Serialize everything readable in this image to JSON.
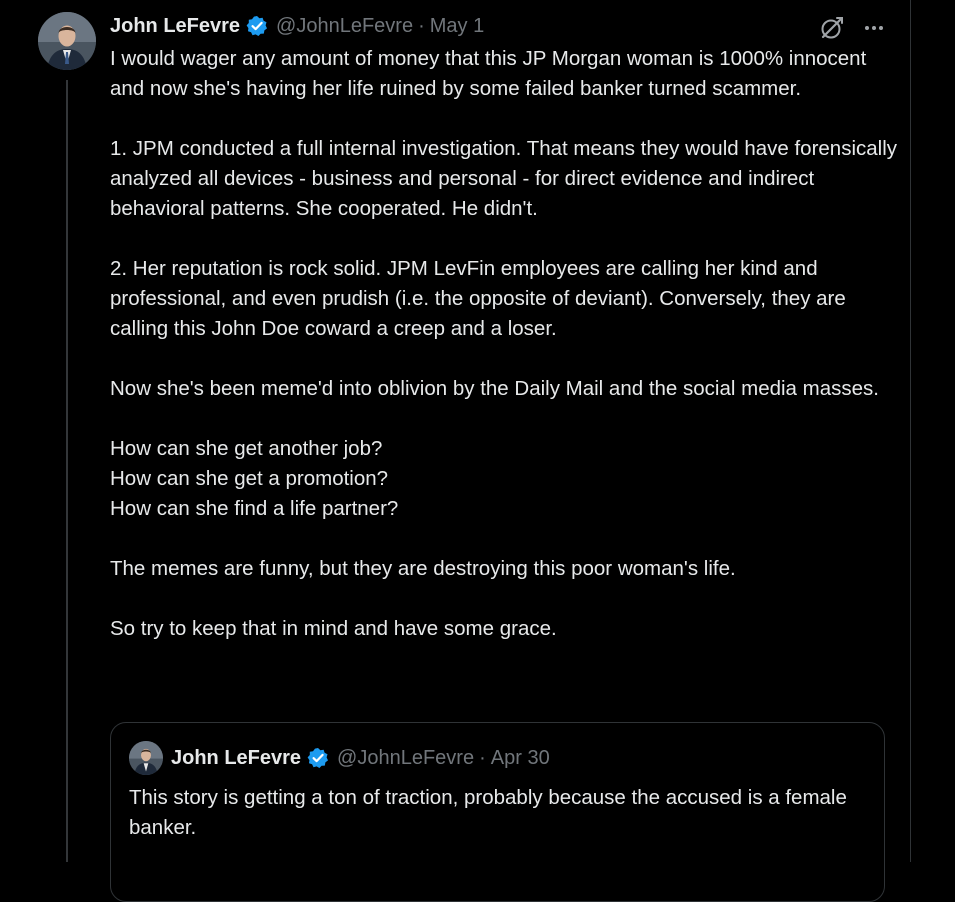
{
  "author": {
    "name": "John LeFevre",
    "handle": "@JohnLeFevre",
    "separator": "·",
    "date": "May 1"
  },
  "tweet": {
    "paragraphs": [
      "I would wager any amount of money that this JP Morgan woman is 1000% innocent and now she's having her life ruined by some failed banker turned scammer.",
      "1. JPM conducted a full internal investigation. That means they would have forensically analyzed all devices - business and personal - for direct evidence and indirect behavioral patterns. She cooperated. He didn't.",
      "2. Her reputation is rock solid. JPM LevFin employees are calling her kind and professional, and even prudish (i.e. the opposite of deviant). Conversely, they are calling this John Doe coward a creep and a loser.",
      "Now she's been meme'd into oblivion by the Daily Mail and the social media masses.",
      "How can she get another job?\nHow can she get a promotion?\nHow can she find a life partner?",
      "The memes are funny, but they are destroying this poor woman's life.",
      "So try to keep that in mind and have some grace."
    ]
  },
  "quote": {
    "name": "John LeFevre",
    "handle": "@JohnLeFevre",
    "separator": "·",
    "date": "Apr 30",
    "text": "This story is getting a ton of traction, probably because the accused is a female banker."
  },
  "icons": {
    "verified": "verified-badge-icon",
    "grok": "grok-icon",
    "more": "more-icon"
  },
  "colors": {
    "background": "#000000",
    "text": "#e7e9ea",
    "muted": "#71767b",
    "verified": "#1d9bf0",
    "border": "#2f3336"
  }
}
